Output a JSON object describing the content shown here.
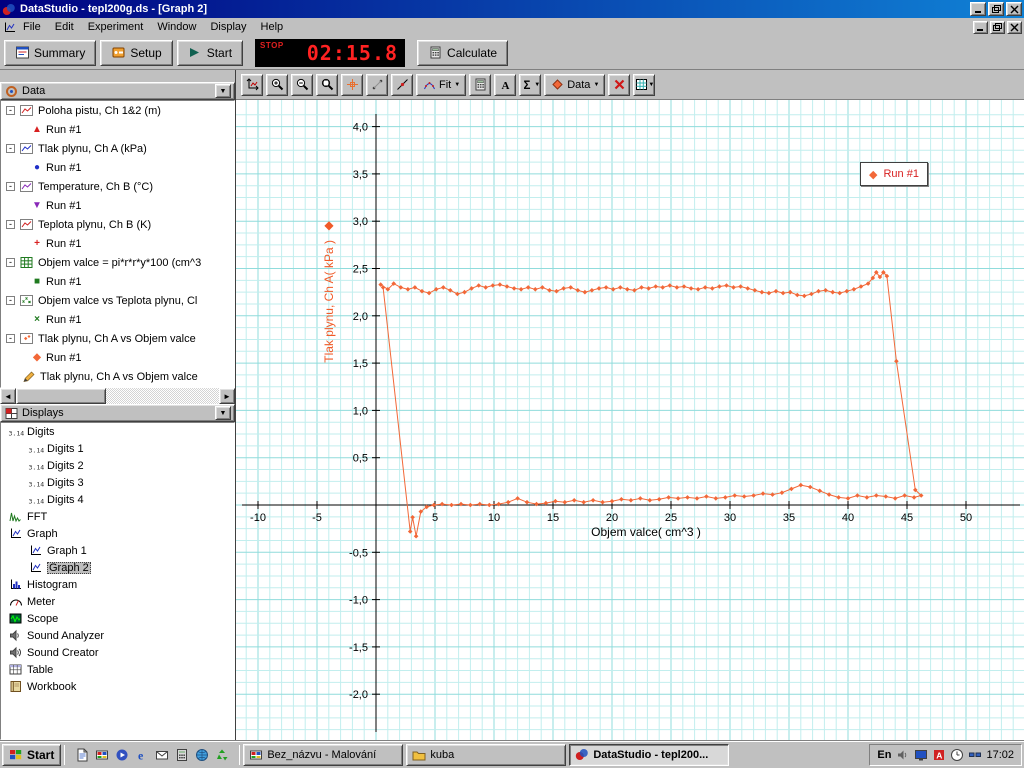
{
  "window": {
    "title": "DataStudio - tepl200g.ds - [Graph 2]"
  },
  "menu_bar": {
    "items": [
      "File",
      "Edit",
      "Experiment",
      "Window",
      "Display",
      "Help"
    ]
  },
  "toolbar": {
    "summary_label": "Summary",
    "setup_label": "Setup",
    "start_label": "Start",
    "calculate_label": "Calculate",
    "timer": {
      "status": "STOP",
      "value": "02:15.8"
    }
  },
  "graph_toolbar": {
    "buttons": [
      {
        "name": "scale-to-fit-button",
        "icon": "scaletofit"
      },
      {
        "name": "zoom-in-button",
        "icon": "zoomin"
      },
      {
        "name": "zoom-out-button",
        "icon": "zoomout"
      },
      {
        "name": "zoom-select-button",
        "icon": "zoomselect"
      },
      {
        "name": "smart-tool-button",
        "icon": "smarttool"
      },
      {
        "name": "note-tool-button",
        "icon": "notetool"
      },
      {
        "name": "slope-tool-button",
        "icon": "slopetool"
      },
      {
        "name": "fit-menu-button",
        "icon": "fitcurve",
        "label": "Fit",
        "dropdown": true
      },
      {
        "name": "calculate-tool-button",
        "icon": "calculator"
      },
      {
        "name": "text-annotation-button",
        "icon": "textA"
      },
      {
        "name": "statistics-menu-button",
        "icon": "sigma",
        "dropdown": true
      },
      {
        "name": "data-menu-button",
        "icon": "datadiamond",
        "label": "Data",
        "dropdown": true
      },
      {
        "name": "remove-button",
        "icon": "redx"
      },
      {
        "name": "graph-settings-button",
        "icon": "gridsettings",
        "dropdown": true
      }
    ]
  },
  "sidebar": {
    "data_panel": {
      "title": "Data",
      "items": [
        {
          "icon": "chartred",
          "label": "Poloha pistu, Ch 1&2 (m)",
          "expandable": true,
          "runs": [
            {
              "marker": "triangle-up",
              "color": "#d82020",
              "label": "Run #1"
            }
          ]
        },
        {
          "icon": "chartblue",
          "label": "Tlak plynu, Ch A (kPa)",
          "expandable": true,
          "runs": [
            {
              "marker": "circle",
              "color": "#2030c8",
              "label": "Run #1"
            }
          ]
        },
        {
          "icon": "chartpurple",
          "label": "Temperature, Ch B (°C)",
          "expandable": true,
          "runs": [
            {
              "marker": "triangle-down",
              "color": "#8828b8",
              "label": "Run #1"
            }
          ]
        },
        {
          "icon": "chartred",
          "label": "Teplota plynu, Ch B (K)",
          "expandable": true,
          "runs": [
            {
              "marker": "plus",
              "color": "#d82020",
              "label": "Run #1"
            }
          ]
        },
        {
          "icon": "calctable",
          "label": "Objem valce = pi*r*r*y*100 (cm^3",
          "expandable": true,
          "runs": [
            {
              "marker": "square",
              "color": "#1f7a1f",
              "label": "Run #1"
            }
          ]
        },
        {
          "icon": "xygreen",
          "label": "Objem valce vs Teplota plynu, Cl",
          "expandable": true,
          "runs": [
            {
              "marker": "x",
              "color": "#1f7a1f",
              "label": "Run #1"
            }
          ]
        },
        {
          "icon": "xyorange",
          "label": "Tlak plynu, Ch A vs Objem valce",
          "expandable": true,
          "runs": [
            {
              "marker": "diamond",
              "color": "#f26838",
              "label": "Run #1"
            }
          ]
        },
        {
          "icon": "pen",
          "label": "Tlak plynu, Ch A vs Objem valce",
          "expandable": false,
          "runs": []
        }
      ]
    },
    "displays_panel": {
      "title": "Displays",
      "items": [
        {
          "icon": "digits",
          "label": "Digits",
          "children": [
            {
              "icon": "digits",
              "label": "Digits 1"
            },
            {
              "icon": "digits",
              "label": "Digits 2"
            },
            {
              "icon": "digits",
              "label": "Digits 3"
            },
            {
              "icon": "digits",
              "label": "Digits 4"
            }
          ]
        },
        {
          "icon": "fft",
          "label": "FFT"
        },
        {
          "icon": "graphicon",
          "label": "Graph",
          "children": [
            {
              "icon": "graphicon",
              "label": "Graph 1"
            },
            {
              "icon": "graphicon",
              "label": "Graph 2",
              "selected": true
            }
          ]
        },
        {
          "icon": "histogram",
          "label": "Histogram"
        },
        {
          "icon": "meter",
          "label": "Meter"
        },
        {
          "icon": "scope",
          "label": "Scope"
        },
        {
          "icon": "speaker",
          "label": "Sound Analyzer"
        },
        {
          "icon": "speaker2",
          "label": "Sound Creator"
        },
        {
          "icon": "tableicon",
          "label": "Table"
        },
        {
          "icon": "workbook",
          "label": "Workbook"
        }
      ]
    }
  },
  "graph": {
    "legend": {
      "label": "Run #1"
    },
    "x_axis": {
      "label": "Objem valce( cm^3 )",
      "ticks": [
        {
          "v": -10,
          "t": "-10"
        },
        {
          "v": -5,
          "t": "-5"
        },
        {
          "v": 5,
          "t": "5"
        },
        {
          "v": 10,
          "t": "10"
        },
        {
          "v": 15,
          "t": "15"
        },
        {
          "v": 20,
          "t": "20"
        },
        {
          "v": 25,
          "t": "25"
        },
        {
          "v": 30,
          "t": "30"
        },
        {
          "v": 35,
          "t": "35"
        },
        {
          "v": 40,
          "t": "40"
        },
        {
          "v": 45,
          "t": "45"
        },
        {
          "v": 50,
          "t": "50"
        }
      ]
    },
    "y_axis": {
      "label": "Tlak plynu, Ch A( kPa )",
      "ticks": [
        {
          "v": 4,
          "t": "4,0"
        },
        {
          "v": 3.5,
          "t": "3,5"
        },
        {
          "v": 3,
          "t": "3,0"
        },
        {
          "v": 2.5,
          "t": "2,5"
        },
        {
          "v": 2,
          "t": "2,0"
        },
        {
          "v": 1.5,
          "t": "1,5"
        },
        {
          "v": 1,
          "t": "1,0"
        },
        {
          "v": 0.5,
          "t": "0,5"
        },
        {
          "v": -0.5,
          "t": "-0,5"
        },
        {
          "v": -1,
          "t": "-1,0"
        },
        {
          "v": -1.5,
          "t": "-1,5"
        },
        {
          "v": -2,
          "t": "-2,0"
        }
      ]
    },
    "colors": {
      "series": "#f26838",
      "grid_minor": "#c2eeee",
      "grid_major": "#90dcdc",
      "legend_text": "#d82020"
    }
  },
  "chart_data": {
    "type": "scatter",
    "title": "",
    "xlabel": "Objem valce( cm^3 )",
    "ylabel": "Tlak plynu, Ch A( kPa )",
    "xlim": [
      -11.8,
      54.9
    ],
    "ylim": [
      -2.57,
      4.28
    ],
    "grid": true,
    "legend_position": "top-right",
    "series": [
      {
        "name": "Run #1",
        "points": [
          [
            0.4,
            2.33
          ],
          [
            1.0,
            2.28
          ],
          [
            1.5,
            2.34
          ],
          [
            2.1,
            2.3
          ],
          [
            2.7,
            2.28
          ],
          [
            3.3,
            2.3
          ],
          [
            3.9,
            2.26
          ],
          [
            4.5,
            2.24
          ],
          [
            5.1,
            2.28
          ],
          [
            5.7,
            2.3
          ],
          [
            6.3,
            2.27
          ],
          [
            6.9,
            2.23
          ],
          [
            7.5,
            2.25
          ],
          [
            8.1,
            2.29
          ],
          [
            8.7,
            2.32
          ],
          [
            9.3,
            2.3
          ],
          [
            9.9,
            2.32
          ],
          [
            10.5,
            2.33
          ],
          [
            11.1,
            2.31
          ],
          [
            11.7,
            2.29
          ],
          [
            12.3,
            2.28
          ],
          [
            12.9,
            2.3
          ],
          [
            13.5,
            2.28
          ],
          [
            14.1,
            2.3
          ],
          [
            14.7,
            2.27
          ],
          [
            15.3,
            2.26
          ],
          [
            15.9,
            2.29
          ],
          [
            16.5,
            2.3
          ],
          [
            17.1,
            2.27
          ],
          [
            17.7,
            2.25
          ],
          [
            18.3,
            2.27
          ],
          [
            18.9,
            2.29
          ],
          [
            19.5,
            2.3
          ],
          [
            20.1,
            2.28
          ],
          [
            20.7,
            2.3
          ],
          [
            21.3,
            2.28
          ],
          [
            21.9,
            2.27
          ],
          [
            22.5,
            2.3
          ],
          [
            23.1,
            2.29
          ],
          [
            23.7,
            2.31
          ],
          [
            24.3,
            2.3
          ],
          [
            24.9,
            2.32
          ],
          [
            25.5,
            2.3
          ],
          [
            26.1,
            2.31
          ],
          [
            26.7,
            2.29
          ],
          [
            27.3,
            2.28
          ],
          [
            27.9,
            2.3
          ],
          [
            28.5,
            2.29
          ],
          [
            29.1,
            2.31
          ],
          [
            29.7,
            2.32
          ],
          [
            30.3,
            2.3
          ],
          [
            30.9,
            2.31
          ],
          [
            31.5,
            2.29
          ],
          [
            32.1,
            2.27
          ],
          [
            32.7,
            2.25
          ],
          [
            33.3,
            2.24
          ],
          [
            33.9,
            2.26
          ],
          [
            34.5,
            2.24
          ],
          [
            35.1,
            2.25
          ],
          [
            35.7,
            2.22
          ],
          [
            36.3,
            2.21
          ],
          [
            36.9,
            2.23
          ],
          [
            37.5,
            2.26
          ],
          [
            38.1,
            2.27
          ],
          [
            38.7,
            2.25
          ],
          [
            39.3,
            2.24
          ],
          [
            39.9,
            2.26
          ],
          [
            40.5,
            2.28
          ],
          [
            41.1,
            2.31
          ],
          [
            41.7,
            2.34
          ],
          [
            42.1,
            2.4
          ],
          [
            42.4,
            2.46
          ],
          [
            42.7,
            2.41
          ],
          [
            43.0,
            2.46
          ],
          [
            43.3,
            2.42
          ],
          [
            44.1,
            1.52
          ],
          [
            45.7,
            0.16
          ],
          [
            46.2,
            0.1
          ],
          [
            45.6,
            0.08
          ],
          [
            44.8,
            0.1
          ],
          [
            44.0,
            0.07
          ],
          [
            43.2,
            0.09
          ],
          [
            42.4,
            0.1
          ],
          [
            41.6,
            0.08
          ],
          [
            40.8,
            0.1
          ],
          [
            40.0,
            0.07
          ],
          [
            39.2,
            0.08
          ],
          [
            38.4,
            0.11
          ],
          [
            37.6,
            0.15
          ],
          [
            36.8,
            0.19
          ],
          [
            36.0,
            0.21
          ],
          [
            35.2,
            0.17
          ],
          [
            34.4,
            0.13
          ],
          [
            33.6,
            0.11
          ],
          [
            32.8,
            0.12
          ],
          [
            32.0,
            0.1
          ],
          [
            31.2,
            0.09
          ],
          [
            30.4,
            0.1
          ],
          [
            29.6,
            0.08
          ],
          [
            28.8,
            0.07
          ],
          [
            28.0,
            0.09
          ],
          [
            27.2,
            0.07
          ],
          [
            26.4,
            0.08
          ],
          [
            25.6,
            0.07
          ],
          [
            24.8,
            0.08
          ],
          [
            24.0,
            0.06
          ],
          [
            23.2,
            0.05
          ],
          [
            22.4,
            0.07
          ],
          [
            21.6,
            0.05
          ],
          [
            20.8,
            0.06
          ],
          [
            20.0,
            0.04
          ],
          [
            19.2,
            0.03
          ],
          [
            18.4,
            0.05
          ],
          [
            17.6,
            0.03
          ],
          [
            16.8,
            0.05
          ],
          [
            16.0,
            0.03
          ],
          [
            15.2,
            0.04
          ],
          [
            14.4,
            0.02
          ],
          [
            13.6,
            0.01
          ],
          [
            12.8,
            0.03
          ],
          [
            12.0,
            0.07
          ],
          [
            11.2,
            0.03
          ],
          [
            10.4,
            0.01
          ],
          [
            9.6,
            0.0
          ],
          [
            8.8,
            0.01
          ],
          [
            8.0,
            0.0
          ],
          [
            7.2,
            0.01
          ],
          [
            6.4,
            0.0
          ],
          [
            5.6,
            0.01
          ],
          [
            4.9,
            0.0
          ],
          [
            4.3,
            -0.02
          ],
          [
            3.8,
            -0.07
          ],
          [
            3.4,
            -0.33
          ],
          [
            3.1,
            -0.13
          ],
          [
            2.9,
            -0.28
          ],
          [
            0.6,
            2.3
          ]
        ]
      }
    ]
  },
  "taskbar": {
    "start_label": "Start",
    "quick_launch": [
      {
        "name": "document-shortcut",
        "icon": "qldoc"
      },
      {
        "name": "paint-shortcut",
        "icon": "qlpaint"
      },
      {
        "name": "media-player-shortcut",
        "icon": "qlmedia"
      },
      {
        "name": "internet-explorer-shortcut",
        "icon": "qlie"
      },
      {
        "name": "mail-shortcut",
        "icon": "qlmail"
      },
      {
        "name": "calculator-shortcut",
        "icon": "qlcalc"
      },
      {
        "name": "browser-shortcut",
        "icon": "qlglobe"
      },
      {
        "name": "recycle-shortcut",
        "icon": "qlrecycle"
      }
    ],
    "tasks": [
      {
        "label": "Bez_názvu - Malování",
        "icon": "qlpaint",
        "active": false
      },
      {
        "label": "kuba",
        "icon": "folder",
        "active": false
      },
      {
        "label": "DataStudio - tepl200...",
        "icon": "dslogo",
        "active": true
      }
    ],
    "tray": {
      "layout": "En",
      "time": "17:02",
      "icons": [
        {
          "name": "volume-tray-icon",
          "icon": "trayspeaker"
        },
        {
          "name": "display-tray-icon",
          "icon": "traydisplay"
        },
        {
          "name": "antivirus-tray-icon",
          "icon": "trayav"
        },
        {
          "name": "scheduler-tray-icon",
          "icon": "traysched"
        },
        {
          "name": "network-tray-icon",
          "icon": "traynet"
        }
      ]
    }
  }
}
